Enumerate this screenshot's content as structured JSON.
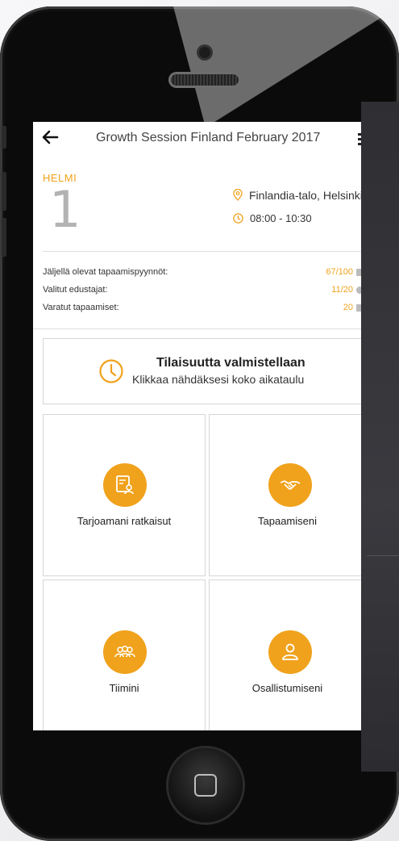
{
  "header": {
    "title": "Growth Session Finland February 2017"
  },
  "event": {
    "day_name": "HELMI",
    "day_number": "1",
    "location": "Finlandia-talo, Helsinki",
    "time": "08:00 - 10:30"
  },
  "stats": [
    {
      "label": "Jäljellä olevat tapaamispyynnöt:",
      "value": "67/100"
    },
    {
      "label": "Valitut edustajat:",
      "value": "11/20"
    },
    {
      "label": "Varatut tapaamiset:",
      "value": "20"
    }
  ],
  "schedule": {
    "title": "Tilaisuutta valmistellaan",
    "subtitle": "Klikkaa nähdäksesi koko aikataulu"
  },
  "tiles": [
    {
      "label": "Tarjoamani ratkaisut",
      "icon": "document-person-icon"
    },
    {
      "label": "Tapaamiseni",
      "icon": "handshake-icon"
    },
    {
      "label": "Tiimini",
      "icon": "team-icon"
    },
    {
      "label": "Osallistumiseni",
      "icon": "person-icon"
    }
  ],
  "colors": {
    "accent": "#f0a21c",
    "phone_body": "#0b0b0b",
    "screen_bg": "#ffffff"
  }
}
